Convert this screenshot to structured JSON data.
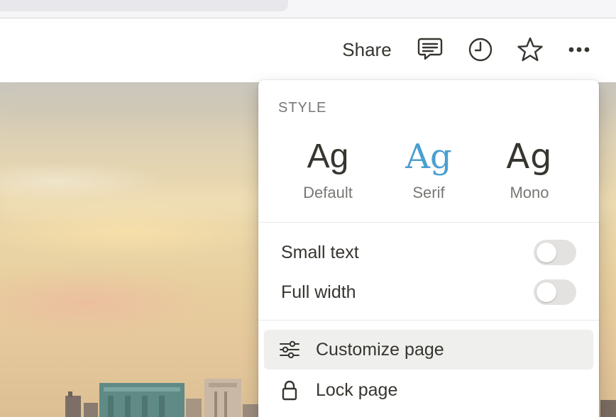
{
  "topbar": {
    "share_label": "Share",
    "icons": [
      "comment-icon",
      "clock-icon",
      "star-icon",
      "more-icon"
    ]
  },
  "style_menu": {
    "section_label": "STYLE",
    "fonts": [
      {
        "sample": "Ag",
        "label": "Default",
        "selected": false
      },
      {
        "sample": "Ag",
        "label": "Serif",
        "selected": true
      },
      {
        "sample": "Ag",
        "label": "Mono",
        "selected": false
      }
    ],
    "toggles": [
      {
        "label": "Small text",
        "on": false
      },
      {
        "label": "Full width",
        "on": false
      }
    ],
    "actions": [
      {
        "label": "Customize page",
        "icon": "sliders-icon",
        "hovered": true
      },
      {
        "label": "Lock page",
        "icon": "lock-icon",
        "hovered": false
      }
    ]
  },
  "colors": {
    "text": "#37352f",
    "muted": "#787774",
    "accent_serif": "#4a9fd0",
    "toggle_off": "#e3e2e0",
    "hover_bg": "#efefee"
  }
}
